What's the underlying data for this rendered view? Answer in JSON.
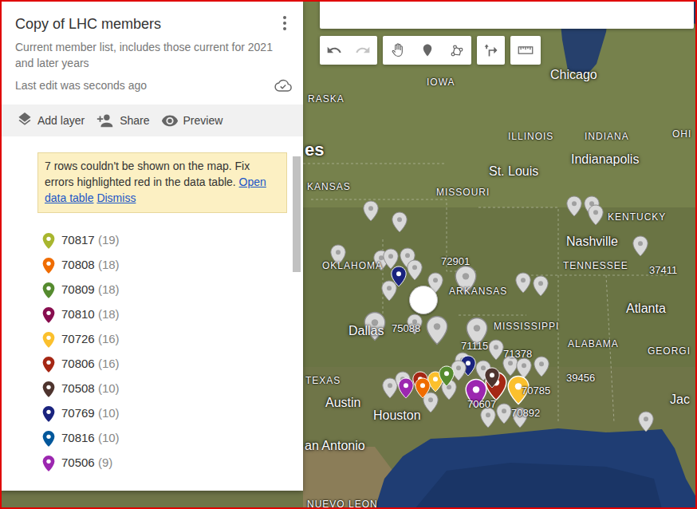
{
  "panel": {
    "title": "Copy of LHC members",
    "description": "Current member list, includes those current for 2021 and later years",
    "last_edit": "Last edit was seconds ago"
  },
  "actions": [
    {
      "label": "Add layer"
    },
    {
      "label": "Share"
    },
    {
      "label": "Preview"
    }
  ],
  "warning": {
    "text": "7 rows couldn't be shown on the map. Fix errors highlighted red in the data table.",
    "links": [
      {
        "label": "Open data table"
      },
      {
        "label": "Dismiss"
      }
    ]
  },
  "legend": [
    {
      "label": "70817",
      "count": "(19)",
      "color": "#a8b62f"
    },
    {
      "label": "70808",
      "count": "(18)",
      "color": "#ef6c00"
    },
    {
      "label": "70809",
      "count": "(18)",
      "color": "#558b2f"
    },
    {
      "label": "70810",
      "count": "(18)",
      "color": "#880e4f"
    },
    {
      "label": "70726",
      "count": "(16)",
      "color": "#fbc02d"
    },
    {
      "label": "70806",
      "count": "(16)",
      "color": "#a52714"
    },
    {
      "label": "70508",
      "count": "(10)",
      "color": "#4e342e"
    },
    {
      "label": "70769",
      "count": "(10)",
      "color": "#1a237e"
    },
    {
      "label": "70816",
      "count": "(10)",
      "color": "#01579b"
    },
    {
      "label": "70506",
      "count": "(9)",
      "color": "#9c27b0"
    }
  ],
  "map": {
    "labels": [
      {
        "text": "RASKA",
        "kind": "state"
      },
      {
        "text": "IOWA",
        "kind": "state"
      },
      {
        "text": "Chicago",
        "kind": "city"
      },
      {
        "text": "ILLINOIS",
        "kind": "state"
      },
      {
        "text": "INDIANA",
        "kind": "state"
      },
      {
        "text": "OHI",
        "kind": "state"
      },
      {
        "text": "es",
        "kind": "country"
      },
      {
        "text": "KANSAS",
        "kind": "state"
      },
      {
        "text": "MISSOURI",
        "kind": "state"
      },
      {
        "text": "St. Louis",
        "kind": "city"
      },
      {
        "text": "Indianapolis",
        "kind": "city"
      },
      {
        "text": "KENTUCKY",
        "kind": "state"
      },
      {
        "text": "Nashville",
        "kind": "city"
      },
      {
        "text": "OKLAHOMA",
        "kind": "state"
      },
      {
        "text": "TENNESSEE",
        "kind": "state"
      },
      {
        "text": "37411",
        "kind": "pin-label"
      },
      {
        "text": "72901",
        "kind": "pin-label"
      },
      {
        "text": "ARKANSAS",
        "kind": "state"
      },
      {
        "text": "Dallas",
        "kind": "city"
      },
      {
        "text": "75088",
        "kind": "pin-label"
      },
      {
        "text": "MISSISSIPPI",
        "kind": "state"
      },
      {
        "text": "71115",
        "kind": "pin-label"
      },
      {
        "text": "71378",
        "kind": "pin-label"
      },
      {
        "text": "ALABAMA",
        "kind": "state"
      },
      {
        "text": "GEORGI",
        "kind": "state"
      },
      {
        "text": "Atlanta",
        "kind": "city"
      },
      {
        "text": "39456",
        "kind": "pin-label"
      },
      {
        "text": "TEXAS",
        "kind": "state"
      },
      {
        "text": "Austin",
        "kind": "city"
      },
      {
        "text": "Houston",
        "kind": "city"
      },
      {
        "text": "70785",
        "kind": "pin-label"
      },
      {
        "text": "70607",
        "kind": "pin-label"
      },
      {
        "text": "70892",
        "kind": "pin-label"
      },
      {
        "text": "Jac",
        "kind": "city"
      },
      {
        "text": "an Antonio",
        "kind": "city"
      },
      {
        "text": "NUEVO LEON",
        "kind": "state"
      }
    ],
    "pins": [
      {
        "kind": "pin",
        "color": "#d9d9d9"
      },
      {
        "kind": "pin",
        "color": "#d9d9d9"
      },
      {
        "kind": "pin",
        "color": "#d9d9d9"
      },
      {
        "kind": "pin",
        "color": "#d9d9d9"
      },
      {
        "kind": "pin",
        "color": "#d9d9d9"
      },
      {
        "kind": "pin",
        "color": "#d9d9d9"
      },
      {
        "kind": "pin",
        "color": "#1a237e"
      },
      {
        "kind": "pin",
        "color": "#d9d9d9"
      },
      {
        "kind": "pin",
        "color": "#d9d9d9"
      },
      {
        "kind": "pin",
        "color": "#d9d9d9"
      },
      {
        "kind": "circle",
        "color": "#ffffff"
      },
      {
        "kind": "pin",
        "color": "#d9d9d9"
      },
      {
        "kind": "pin",
        "color": "#d9d9d9"
      },
      {
        "kind": "pin",
        "color": "#d9d9d9"
      },
      {
        "kind": "pin",
        "color": "#d9d9d9"
      },
      {
        "kind": "pin",
        "color": "#d9d9d9"
      },
      {
        "kind": "pin",
        "color": "#d9d9d9"
      },
      {
        "kind": "pin",
        "color": "#d9d9d9"
      },
      {
        "kind": "pin",
        "color": "#d9d9d9"
      },
      {
        "kind": "pin",
        "color": "#d9d9d9"
      },
      {
        "kind": "pin",
        "color": "#d9d9d9"
      },
      {
        "kind": "pin",
        "color": "#d9d9d9"
      },
      {
        "kind": "pin",
        "color": "#d9d9d9"
      },
      {
        "kind": "pin",
        "color": "#d9d9d9"
      },
      {
        "kind": "pin",
        "color": "#d9d9d9"
      },
      {
        "kind": "pin",
        "color": "#d9d9d9"
      },
      {
        "kind": "pin",
        "color": "#d9d9d9"
      },
      {
        "kind": "pin",
        "color": "#d9d9d9"
      },
      {
        "kind": "pin",
        "color": "#1a237e"
      },
      {
        "kind": "pin",
        "color": "#d9d9d9"
      },
      {
        "kind": "pin",
        "color": "#d9d9d9"
      },
      {
        "kind": "pin",
        "color": "#9c27b0"
      },
      {
        "kind": "pin",
        "color": "#a52714"
      },
      {
        "kind": "pin",
        "color": "#fbc02d"
      },
      {
        "kind": "pin",
        "color": "#d9d9d9"
      },
      {
        "kind": "pin",
        "color": "#d9d9d9"
      },
      {
        "kind": "pin",
        "color": "#9c27b0"
      },
      {
        "kind": "pin",
        "color": "#a52714"
      },
      {
        "kind": "pin",
        "color": "#fbc02d"
      },
      {
        "kind": "pin",
        "color": "#d9d9d9"
      },
      {
        "kind": "pin",
        "color": "#d9d9d9"
      },
      {
        "kind": "pin",
        "color": "#d9d9d9"
      },
      {
        "kind": "pin",
        "color": "#d9d9d9"
      },
      {
        "kind": "pin",
        "color": "#d9d9d9"
      },
      {
        "kind": "pin",
        "color": "#ef6c00"
      },
      {
        "kind": "pin",
        "color": "#558b2f"
      },
      {
        "kind": "pin",
        "color": "#4e342e"
      }
    ]
  }
}
